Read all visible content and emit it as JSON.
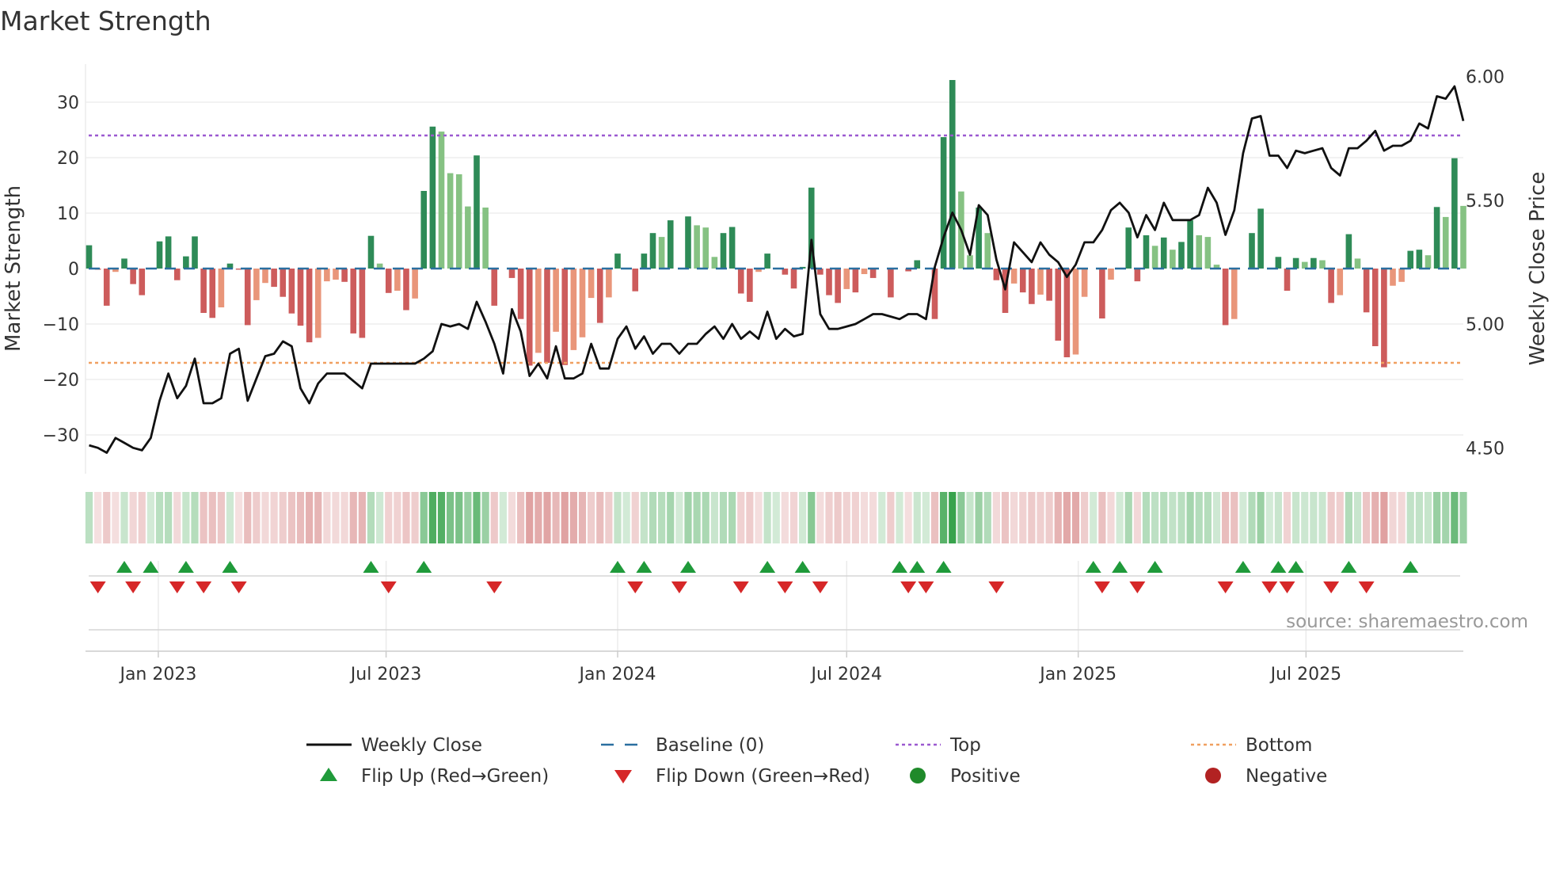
{
  "title": "Market Strength",
  "source": "source: sharemaestro.com",
  "colors": {
    "up_strong": "#2e8b57",
    "up_weak": "#86c283",
    "down_strong": "#cd5c5c",
    "down_weak": "#e9967a",
    "baseline": "#2a6fa0",
    "top": "#9b59d0",
    "bottom": "#f0a060",
    "close": "#111111",
    "flip_up": "#1f9a3a",
    "flip_down": "#d62728",
    "positive": "#1f8a2a",
    "negative": "#b22222"
  },
  "chart_data": {
    "type": "bar",
    "title": "Market Strength",
    "ylabel": "Market Strength",
    "y2label": "Weekly Close Price",
    "ylim": [
      -37,
      38
    ],
    "y2lim": [
      4.4,
      6.05
    ],
    "yticks": [
      -30,
      -20,
      -10,
      0,
      10,
      20,
      30
    ],
    "yticklabels": [
      "−30",
      "−20",
      "−10",
      "0",
      "10",
      "20",
      "30"
    ],
    "y2ticks": [
      4.5,
      5.0,
      5.5,
      6.0
    ],
    "y2ticklabels": [
      "4.50",
      "5.00",
      "5.50",
      "6.00"
    ],
    "start_date": "2022-11-07",
    "interval": "weekly",
    "xticks": [
      {
        "label": "Jan 2023",
        "date": "2023-01-01"
      },
      {
        "label": "Jul 2023",
        "date": "2023-07-01"
      },
      {
        "label": "Jan 2024",
        "date": "2024-01-01"
      },
      {
        "label": "Jul 2024",
        "date": "2024-07-01"
      },
      {
        "label": "Jan 2025",
        "date": "2025-01-01"
      },
      {
        "label": "Jul 2025",
        "date": "2025-07-01"
      }
    ],
    "baseline": 0,
    "top": 24,
    "bottom": -17,
    "strength": [
      4.2,
      -0.2,
      -6.7,
      -0.6,
      1.8,
      -2.8,
      -4.8,
      0,
      4.9,
      5.8,
      -2.1,
      2.2,
      5.8,
      -8,
      -8.9,
      -7,
      0.9,
      -0.2,
      -10.2,
      -5.7,
      -2.6,
      -3.3,
      -5.1,
      -8.1,
      -10.3,
      -13.3,
      -12.5,
      -2.3,
      -2,
      -2.4,
      -11.7,
      -12.5,
      5.9,
      0.9,
      -4.4,
      -4,
      -7.5,
      -5.4,
      14,
      25.6,
      24.7,
      17.2,
      17,
      11.2,
      20.4,
      11,
      -6.7,
      0,
      -1.7,
      -9.1,
      -17.5,
      -15.2,
      -17,
      -11.4,
      -17.4,
      -14.7,
      -12.4,
      -5.3,
      -9.8,
      -5.2,
      2.7,
      0,
      -4.1,
      2.7,
      6.4,
      5.7,
      8.7,
      0,
      9.4,
      7.8,
      7.4,
      2.1,
      6.4,
      7.5,
      -4.5,
      -6,
      -0.6,
      2.7,
      0,
      -1.1,
      -3.6,
      0.3,
      14.6,
      -1.1,
      -4.8,
      -6.2,
      -3.7,
      -4.3,
      -1,
      -1.7,
      0,
      -5.2,
      0,
      -0.5,
      1.5,
      0,
      -9.1,
      23.7,
      34,
      13.9,
      2.4,
      11,
      6.4,
      -2.1,
      -8,
      -2.7,
      -4.3,
      -6.4,
      -4.7,
      -5.8,
      -13,
      -16,
      -15.5,
      -5.1,
      0,
      -9,
      -2,
      0,
      7.4,
      -2.3,
      6,
      4.1,
      5.6,
      3.4,
      4.8,
      8.7,
      6,
      5.7,
      0.7,
      -10.2,
      -9.1,
      0,
      6.4,
      10.8,
      0,
      2.1,
      -4,
      1.9,
      1.2,
      1.9,
      1.5,
      -6.2,
      -4.8,
      6.2,
      1.8,
      -7.9,
      -14,
      -17.8,
      -3.1,
      -2.4,
      3.2,
      3.4,
      2.4,
      11.1,
      9.3,
      19.9,
      11.3
    ],
    "weekly_close": [
      4.51,
      4.5,
      4.48,
      4.54,
      4.52,
      4.5,
      4.49,
      4.54,
      4.69,
      4.8,
      4.7,
      4.75,
      4.86,
      4.68,
      4.68,
      4.7,
      4.88,
      4.9,
      4.69,
      4.78,
      4.87,
      4.88,
      4.93,
      4.91,
      4.74,
      4.68,
      4.76,
      4.8,
      4.8,
      4.8,
      4.77,
      4.74,
      4.84,
      4.84,
      4.84,
      4.84,
      4.84,
      4.84,
      4.86,
      4.89,
      5.0,
      4.99,
      5.0,
      4.98,
      5.09,
      5.01,
      4.92,
      4.8,
      5.06,
      4.97,
      4.79,
      4.84,
      4.78,
      4.91,
      4.78,
      4.78,
      4.8,
      4.92,
      4.82,
      4.82,
      4.94,
      4.99,
      4.9,
      4.95,
      4.88,
      4.92,
      4.92,
      4.88,
      4.92,
      4.92,
      4.96,
      4.99,
      4.94,
      5.0,
      4.94,
      4.97,
      4.94,
      5.05,
      4.94,
      4.98,
      4.95,
      4.96,
      5.34,
      5.04,
      4.98,
      4.98,
      4.99,
      5.0,
      5.02,
      5.04,
      5.04,
      5.03,
      5.02,
      5.04,
      5.04,
      5.02,
      5.23,
      5.35,
      5.45,
      5.38,
      5.28,
      5.48,
      5.44,
      5.26,
      5.14,
      5.33,
      5.29,
      5.25,
      5.33,
      5.28,
      5.25,
      5.19,
      5.24,
      5.33,
      5.33,
      5.38,
      5.46,
      5.49,
      5.45,
      5.35,
      5.44,
      5.38,
      5.49,
      5.42,
      5.42,
      5.42,
      5.44,
      5.55,
      5.49,
      5.36,
      5.46,
      5.69,
      5.83,
      5.84,
      5.68,
      5.68,
      5.63,
      5.7,
      5.69,
      5.7,
      5.71,
      5.63,
      5.6,
      5.71,
      5.71,
      5.74,
      5.78,
      5.7,
      5.72,
      5.72,
      5.74,
      5.81,
      5.79,
      5.92,
      5.91,
      5.96,
      5.82
    ],
    "flip_up_weeks": [
      4,
      7,
      11,
      16,
      32,
      38,
      60,
      63,
      68,
      77,
      81,
      92,
      94,
      97,
      114,
      117,
      121,
      131,
      135,
      137,
      143,
      150
    ],
    "flip_down_weeks": [
      1,
      5,
      10,
      13,
      17,
      34,
      46,
      62,
      67,
      74,
      79,
      83,
      93,
      95,
      103,
      115,
      119,
      129,
      134,
      136,
      141,
      145
    ],
    "legend": [
      {
        "label": "Weekly Close",
        "symbol": "line"
      },
      {
        "label": "Baseline (0)",
        "symbol": "dash"
      },
      {
        "label": "Top",
        "symbol": "dot-purple"
      },
      {
        "label": "Bottom",
        "symbol": "dot-orange"
      },
      {
        "label": "Flip Up (Red→Green)",
        "symbol": "triangle-up"
      },
      {
        "label": "Flip Down (Green→Red)",
        "symbol": "triangle-down"
      },
      {
        "label": "Positive",
        "symbol": "circle-green"
      },
      {
        "label": "Negative",
        "symbol": "circle-red"
      }
    ],
    "legend_position": "bottom"
  }
}
